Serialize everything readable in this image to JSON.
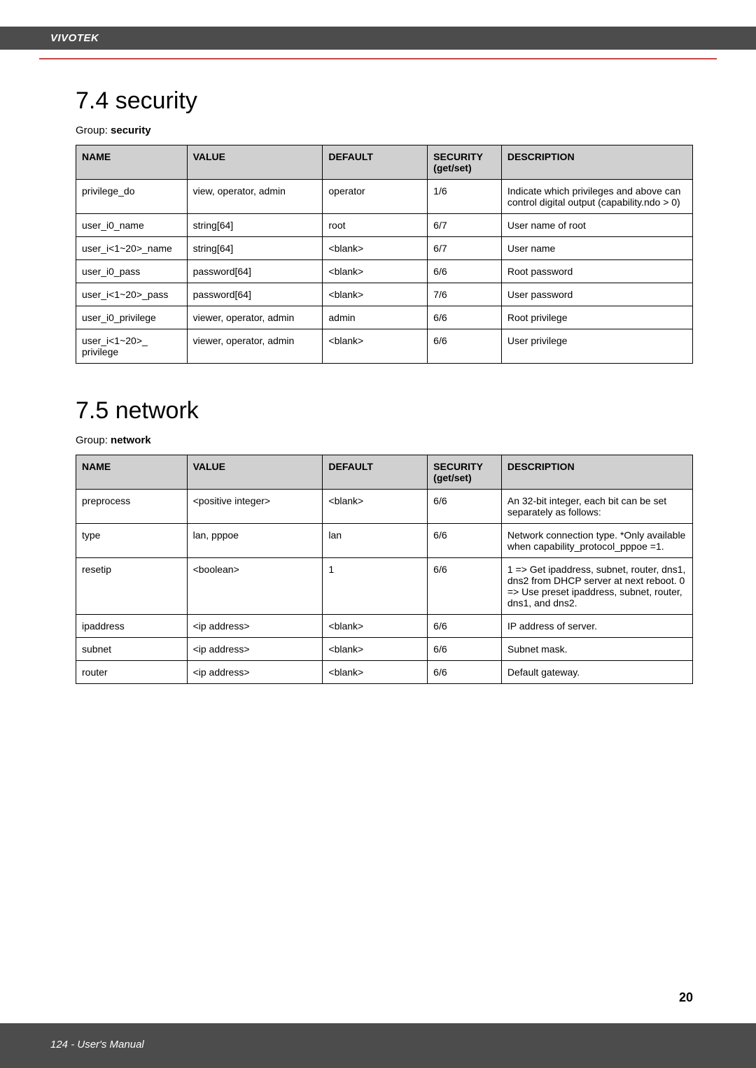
{
  "brand": "VIVOTEK",
  "footer": "124 - User's Manual",
  "page_number": "20",
  "section_security": {
    "heading": "7.4 security",
    "group_label": "Group:",
    "group_value": "security",
    "columns": [
      "NAME",
      "VALUE",
      "DEFAULT",
      "SECURITY (get/set)",
      "DESCRIPTION"
    ],
    "rows": [
      {
        "name": "privilege_do",
        "value": "view, operator, admin",
        "default": "operator",
        "security": "1/6",
        "description": "Indicate which privileges and above can control digital output (capability.ndo > 0)"
      },
      {
        "name": "user_i0_name",
        "value": "string[64]",
        "default": "root",
        "security": "6/7",
        "description": "User name of root"
      },
      {
        "name": "user_i<1~20>_name",
        "value": "string[64]",
        "default": "<blank>",
        "security": "6/7",
        "description": "User name"
      },
      {
        "name": "user_i0_pass",
        "value": "password[64]",
        "default": "<blank>",
        "security": "6/6",
        "description": "Root password"
      },
      {
        "name": "user_i<1~20>_pass",
        "value": "password[64]",
        "default": "<blank>",
        "security": "7/6",
        "description": "User password"
      },
      {
        "name": "user_i0_privilege",
        "value": "viewer, operator, admin",
        "default": "admin",
        "security": "6/6",
        "description": "Root privilege"
      },
      {
        "name": "user_i<1~20>_ privilege",
        "value": "viewer, operator, admin",
        "default": "<blank>",
        "security": "6/6",
        "description": "User privilege"
      }
    ]
  },
  "section_network": {
    "heading": "7.5 network",
    "group_label": "Group:",
    "group_value": "network",
    "columns": [
      "NAME",
      "VALUE",
      "DEFAULT",
      "SECURITY (get/set)",
      "DESCRIPTION"
    ],
    "rows": [
      {
        "name": "preprocess",
        "value": "<positive integer>",
        "default": "<blank>",
        "security": "6/6",
        "description": "An 32-bit integer, each bit can be set separately as follows:"
      },
      {
        "name": "type",
        "value": "lan, pppoe",
        "default": "lan",
        "security": "6/6",
        "description": "Network connection type. *Only available when capability_protocol_pppoe =1."
      },
      {
        "name": "resetip",
        "value": "<boolean>",
        "default": "1",
        "security": "6/6",
        "description": "1 => Get ipaddress, subnet, router, dns1, dns2 from DHCP server at next reboot. 0 => Use preset ipaddress, subnet, router, dns1, and dns2."
      },
      {
        "name": "ipaddress",
        "value": "<ip address>",
        "default": "<blank>",
        "security": "6/6",
        "description": "IP address of server."
      },
      {
        "name": "subnet",
        "value": "<ip address>",
        "default": "<blank>",
        "security": "6/6",
        "description": "Subnet mask."
      },
      {
        "name": "router",
        "value": "<ip address>",
        "default": "<blank>",
        "security": "6/6",
        "description": "Default gateway."
      }
    ]
  }
}
